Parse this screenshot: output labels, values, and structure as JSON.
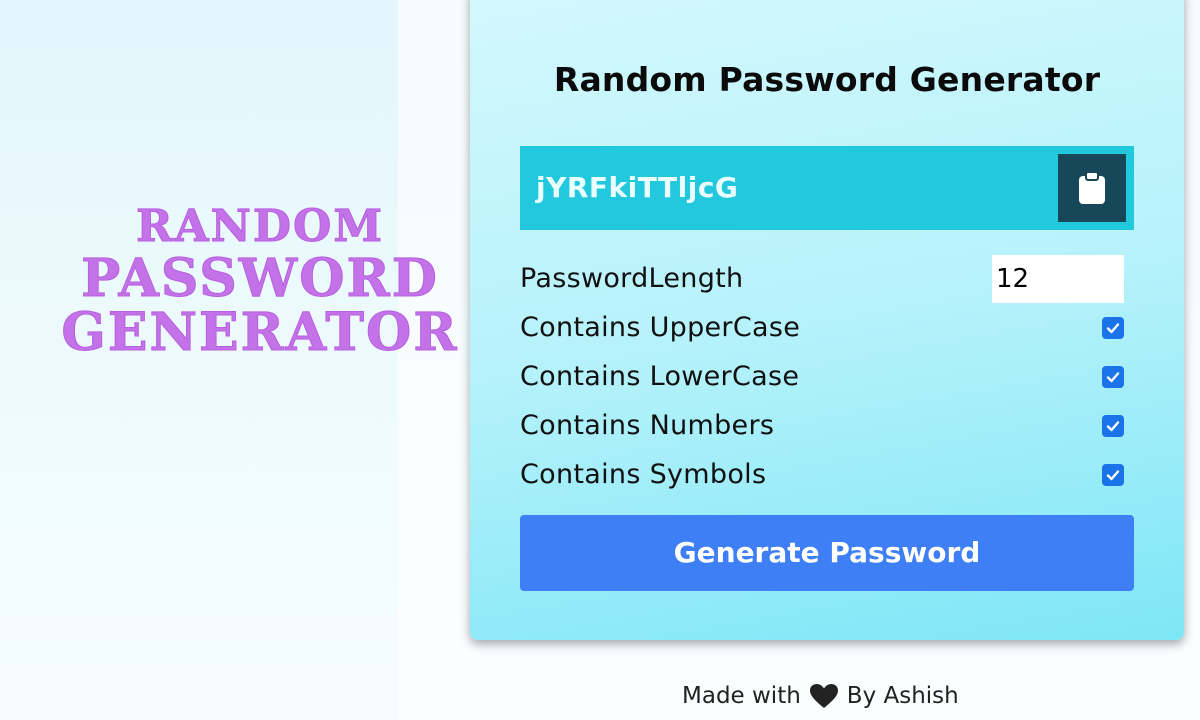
{
  "promo": {
    "line1": "RANDOM",
    "line2": "PASSWORD",
    "line3": "GENERATOR",
    "color": "#c472e8"
  },
  "card": {
    "title": "Random Password Generator",
    "result": {
      "password": "jYRFkiTTljcG",
      "copy_icon": "clipboard-icon"
    },
    "settings": {
      "length": {
        "label": "PasswordLength",
        "value": "12"
      },
      "uppercase": {
        "label": "Contains UpperCase",
        "checked": true
      },
      "lowercase": {
        "label": "Contains LowerCase",
        "checked": true
      },
      "numbers": {
        "label": "Contains Numbers",
        "checked": true
      },
      "symbols": {
        "label": "Contains Symbols",
        "checked": true
      }
    },
    "generate_label": "Generate Password"
  },
  "footer": {
    "made_with": "Made with",
    "heart_icon": "heart-icon",
    "by": "By Ashish"
  },
  "colors": {
    "accent": "#3e7ff5",
    "checkbox": "#1a73e8",
    "result_bg": "#22c9de",
    "clipboard_btn": "#17485a"
  }
}
